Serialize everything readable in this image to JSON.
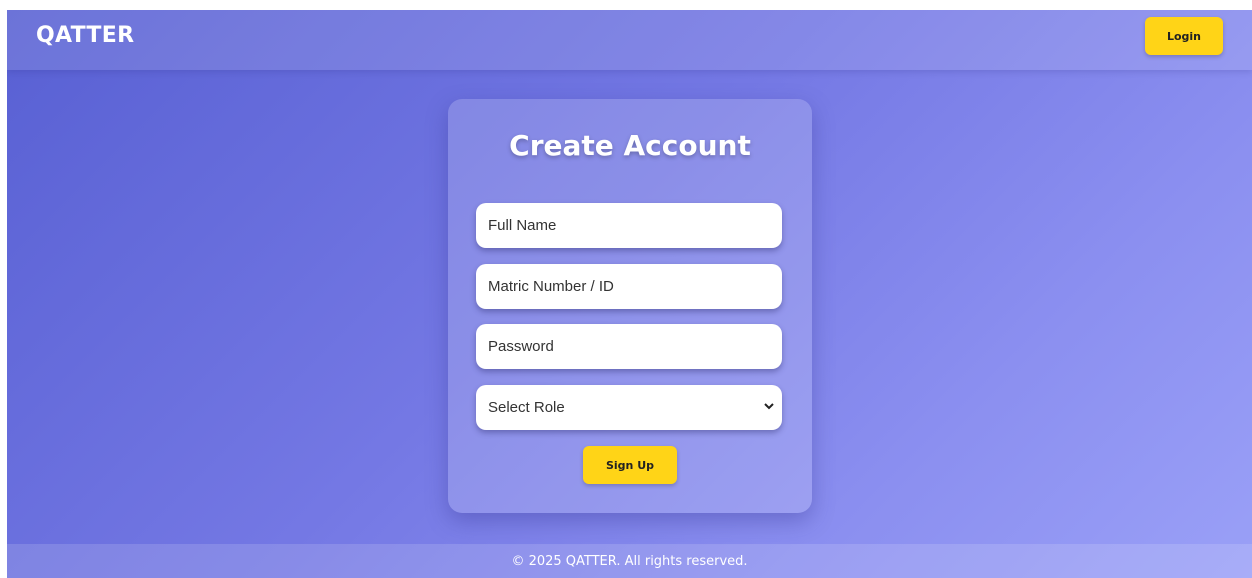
{
  "header": {
    "brand": "QATTER",
    "login_label": "Login"
  },
  "form": {
    "title": "Create Account",
    "full_name_placeholder": "Full Name",
    "matric_placeholder": "Matric Number / ID",
    "password_placeholder": "Password",
    "role_select_value": "Select Role",
    "submit_label": "Sign Up"
  },
  "footer": {
    "text": "© 2025 QATTER. All rights reserved."
  },
  "colors": {
    "accent_button": "#ffd417",
    "background_start": "#5860d3",
    "background_end": "#9aa0f7"
  },
  "icons": {
    "role_dropdown": "chevron-down-icon"
  }
}
